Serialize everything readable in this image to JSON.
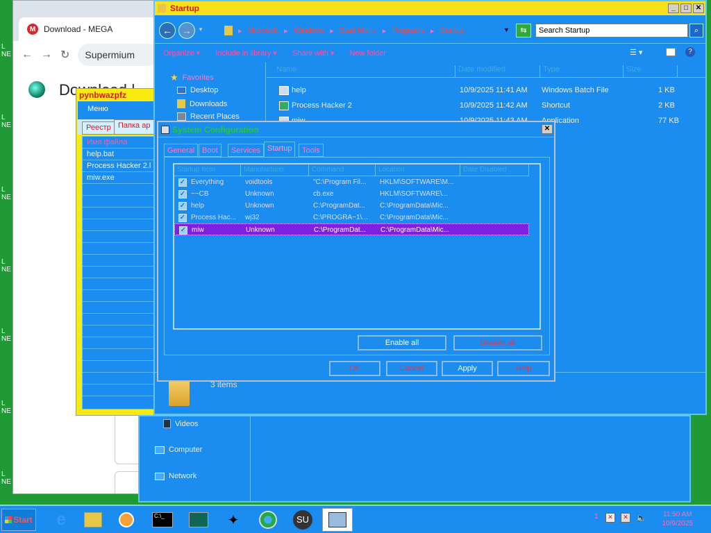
{
  "desktop": {
    "side_labels": [
      "L NE",
      "L NE",
      "L NE",
      "L NE",
      "L NE",
      "L NE",
      "L NE"
    ]
  },
  "chrome": {
    "tab_title": "Download - MEGA",
    "address_text": "Supermium",
    "page_title": "Download |"
  },
  "pynbw": {
    "title": "pynbwazpfz",
    "menu": "Меню",
    "tabs": [
      "Реестр",
      "Папка ар"
    ],
    "list_header": "Имя файла",
    "files": [
      "help.bat",
      "Process Hacker 2.l",
      "miw.exe"
    ]
  },
  "explorer": {
    "title": "Startup",
    "breadcrumb": [
      "Microsoft",
      "Windows",
      "Start Menu",
      "Programs",
      "Startup"
    ],
    "search_placeholder": "Search Startup",
    "commands": [
      "Organize",
      "Include in library",
      "Share with",
      "New folder"
    ],
    "nav": {
      "favorites": "Favorites",
      "items": [
        "Desktop",
        "Downloads",
        "Recent Places"
      ],
      "lower_items": [
        "Videos",
        "Computer",
        "Network"
      ]
    },
    "columns": [
      "Name",
      "Date modified",
      "Type",
      "Size"
    ],
    "files": [
      {
        "name": "help",
        "date": "10/9/2025 11:41 AM",
        "type": "Windows Batch File",
        "size": "1 KB"
      },
      {
        "name": "Process Hacker 2",
        "date": "10/9/2025 11:42 AM",
        "type": "Shortcut",
        "size": "2 KB"
      },
      {
        "name": "miw",
        "date": "10/9/2025 11:43 AM",
        "type": "Application",
        "size": "77 KB"
      }
    ],
    "status_count": "3 items"
  },
  "msconfig": {
    "title": "System Configuration",
    "tabs": [
      "General",
      "Boot",
      "Services",
      "Startup",
      "Tools"
    ],
    "active_tab": "Startup",
    "columns": [
      "Startup Item",
      "Manufacturer",
      "Command",
      "Location",
      "Date Disabled"
    ],
    "rows": [
      {
        "item": "Everything",
        "manufacturer": "voidtools",
        "command": "\"C:\\Program Fil...",
        "location": "HKLM\\SOFTWARE\\M...",
        "selected": false
      },
      {
        "item": "~~CB",
        "manufacturer": "Unknown",
        "command": "cb.exe",
        "location": "HKLM\\SOFTWARE\\...",
        "selected": false
      },
      {
        "item": "help",
        "manufacturer": "Unknown",
        "command": "C:\\ProgramDat...",
        "location": "C:\\ProgramData\\Mic...",
        "selected": false
      },
      {
        "item": "Process Hac...",
        "manufacturer": "wj32",
        "command": "C:\\PROGRA~1\\...",
        "location": "C:\\ProgramData\\Mic...",
        "selected": false
      },
      {
        "item": "miw",
        "manufacturer": "Unknown",
        "command": "C:\\ProgramDat...",
        "location": "C:\\ProgramData\\Mic...",
        "selected": true
      }
    ],
    "enable_all": "Enable all",
    "disable_all": "Disable all",
    "ok": "OK",
    "cancel": "Cancel",
    "apply": "Apply",
    "help": "Help"
  },
  "taskbar": {
    "start_label": "Start",
    "apps": [
      "internet-explorer-icon",
      "file-explorer-icon",
      "media-player-icon",
      "command-prompt-icon",
      "task-manager-icon",
      "magic-wand-icon",
      "chrome-icon",
      "supermium-icon",
      "msconfig-icon"
    ],
    "time": "11:50 AM",
    "date": "10/9/2025",
    "tray_number": "1"
  },
  "colors": {
    "window_bg": "#1b8cf0",
    "title_yellow": "#f7e11c",
    "selection": "#7f1fe0",
    "desktop": "#1f9a35"
  }
}
